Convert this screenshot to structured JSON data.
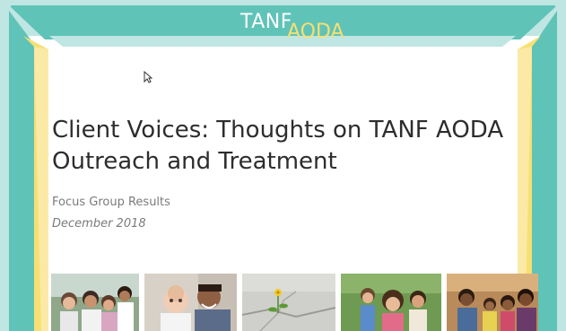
{
  "slide": {
    "logo": {
      "part1": "TANF",
      "part2": "AODA"
    },
    "title_line1": "Client Voices:  Thoughts on TANF AODA",
    "title_line2": "Outreach and Treatment",
    "subtitle": "Focus Group Results",
    "date": "December 2018"
  },
  "photos": [
    {
      "name": "family-photo",
      "description": "family-outdoors"
    },
    {
      "name": "father-baby-photo",
      "description": "father-with-baby"
    },
    {
      "name": "flower-sidewalk-photo",
      "description": "flower-in-crack"
    },
    {
      "name": "mother-kids-photo",
      "description": "mother-with-children"
    },
    {
      "name": "family-group-photo",
      "description": "group-family"
    }
  ],
  "colors": {
    "teal": "#5fc3b8",
    "light_teal": "#bfe6e2",
    "yellow": "#f7df73",
    "title_text": "#2d2d2d",
    "subtle_text": "#7b7b7b"
  }
}
